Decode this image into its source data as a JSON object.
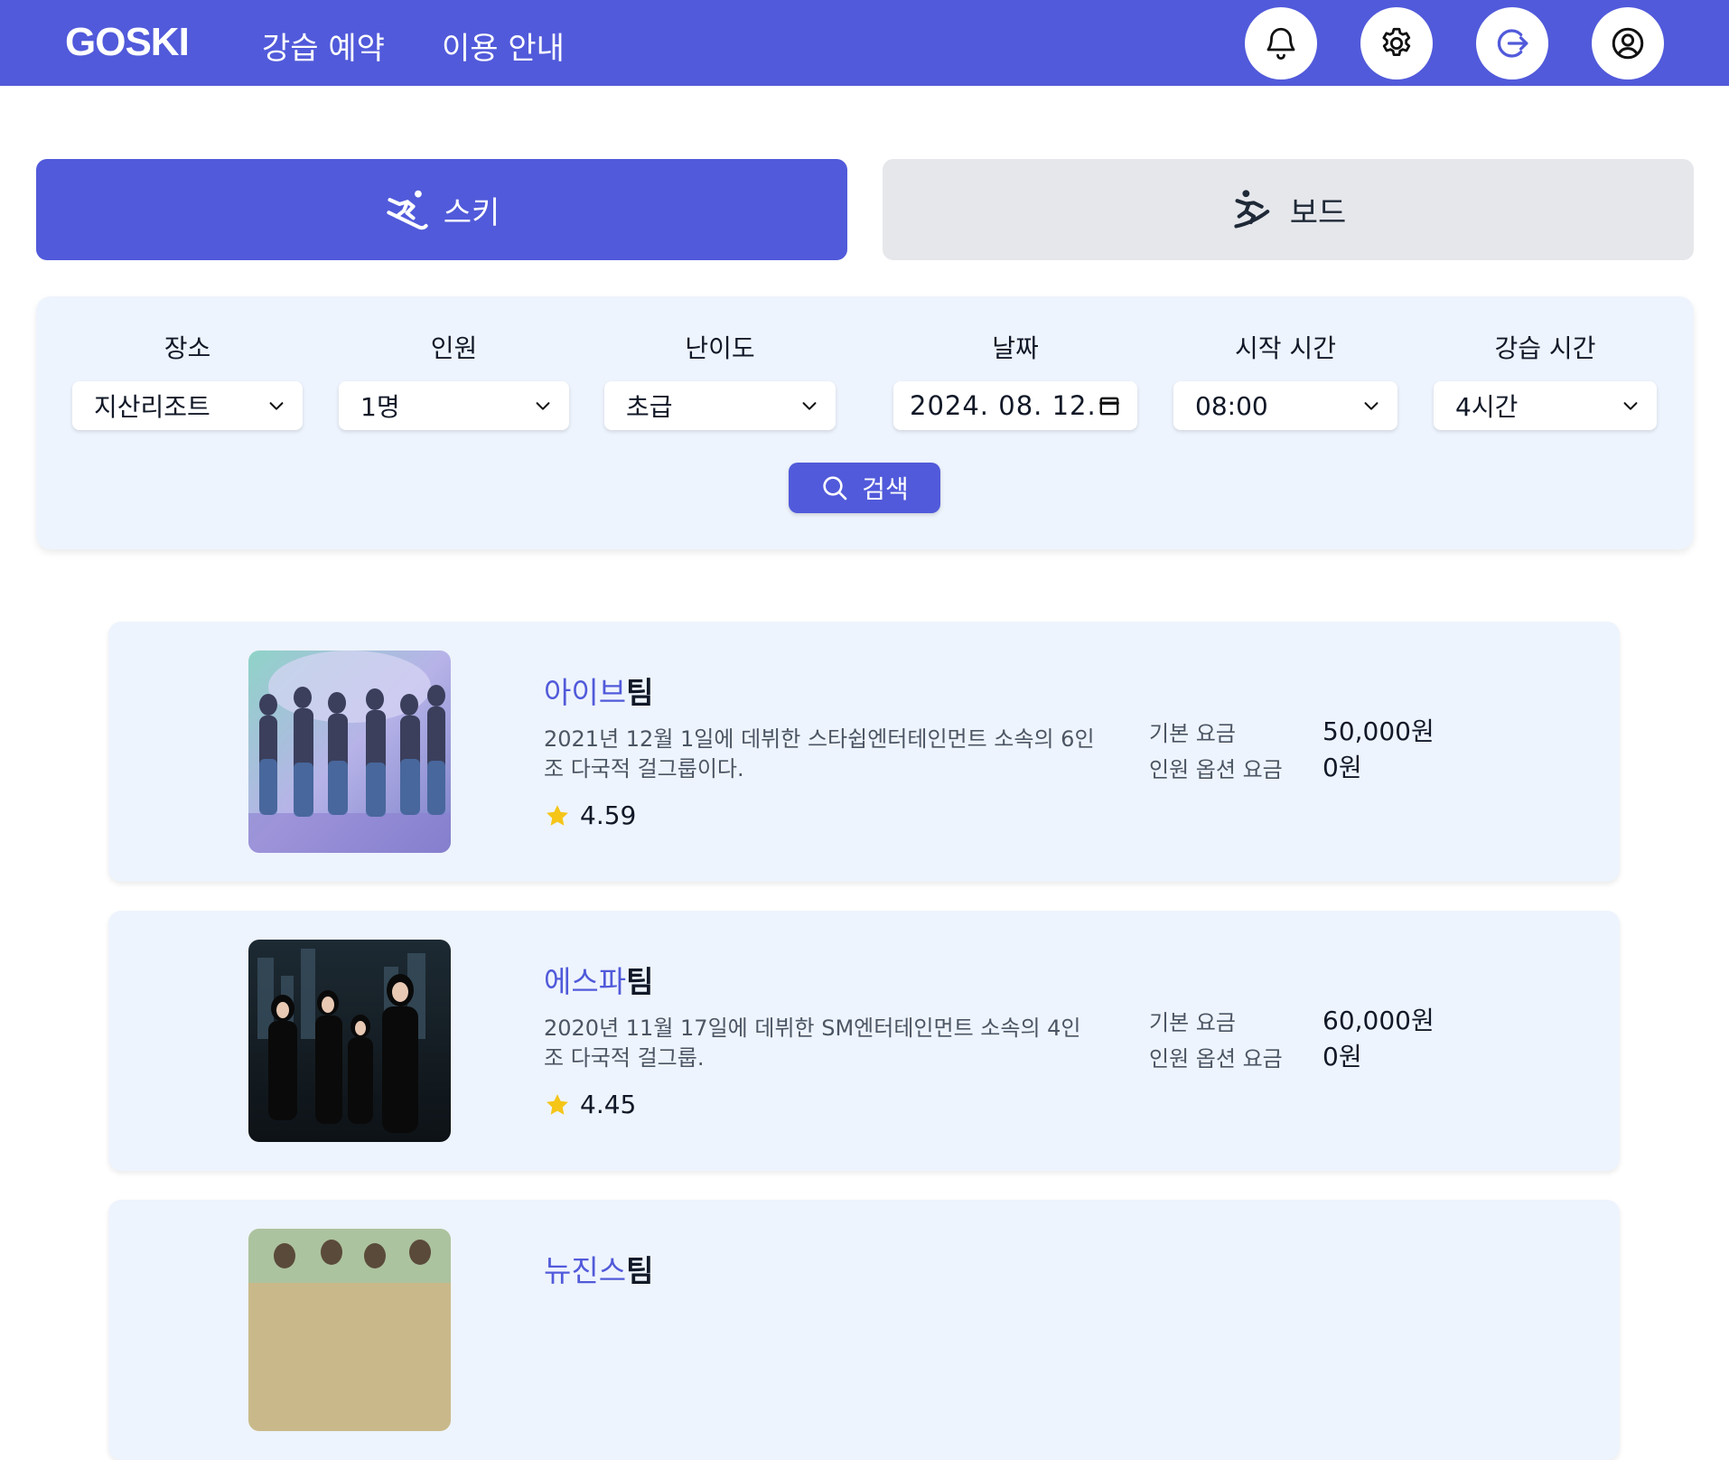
{
  "header": {
    "logo": "GOSKI",
    "nav": [
      "강습 예약",
      "이용 안내"
    ],
    "icons": [
      "bell-icon",
      "gear-icon",
      "logout-icon",
      "user-circle-icon"
    ]
  },
  "tabs": {
    "ski": "스키",
    "board": "보드"
  },
  "filters": {
    "location": {
      "label": "장소",
      "value": "지산리조트"
    },
    "people": {
      "label": "인원",
      "value": "1명"
    },
    "level": {
      "label": "난이도",
      "value": "초급"
    },
    "date": {
      "label": "날짜",
      "value": "2024. 08. 12."
    },
    "start_time": {
      "label": "시작 시간",
      "value": "08:00"
    },
    "duration": {
      "label": "강습 시간",
      "value": "4시간"
    },
    "search_label": "검색"
  },
  "teams": [
    {
      "name": "아이브",
      "suffix": "팀",
      "description": "2021년 12월 1일에 데뷔한 스타쉽엔터테인먼트 소속의 6인조 다국적 걸그룹이다.",
      "rating": "4.59",
      "base_fee_label": "기본 요금",
      "base_fee": "50,000원",
      "option_fee_label": "인원 옵션 요금",
      "option_fee": "0원"
    },
    {
      "name": "에스파",
      "suffix": "팀",
      "description": "2020년 11월 17일에 데뷔한 SM엔터테인먼트 소속의 4인조 다국적 걸그룹.",
      "rating": "4.45",
      "base_fee_label": "기본 요금",
      "base_fee": "60,000원",
      "option_fee_label": "인원 옵션 요금",
      "option_fee": "0원"
    },
    {
      "name": "뉴진스",
      "suffix": "팀"
    }
  ],
  "colors": {
    "primary": "#515ada",
    "panel": "#eef4fd",
    "inactive_tab": "#e5e7eb",
    "star": "#f5c518"
  }
}
